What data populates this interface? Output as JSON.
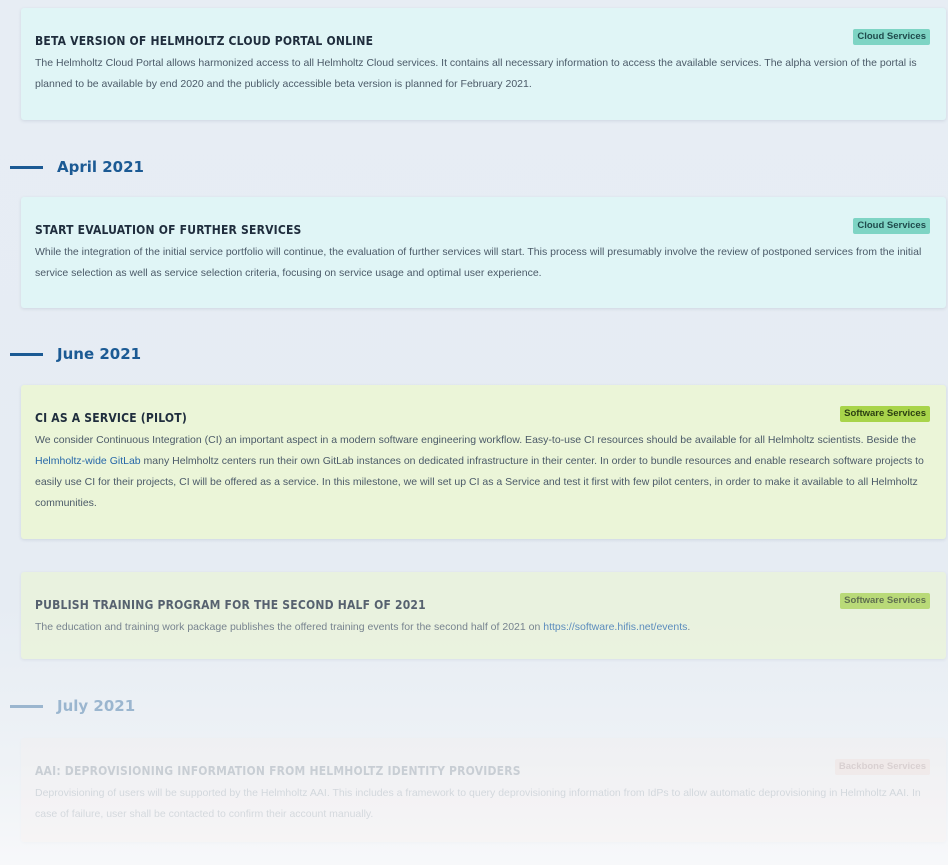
{
  "milestones": [
    {
      "title": "BETA VERSION OF HELMHOLTZ CLOUD PORTAL ONLINE",
      "badge": "Cloud Services",
      "text": "The Helmholtz Cloud Portal allows harmonized access to all Helmholtz Cloud services. It contains all necessary information to access the available services. The alpha version of the portal is planned to be available by end 2020 and the publicly accessible beta version is planned for February 2021."
    },
    {
      "title": "START EVALUATION OF FURTHER SERVICES",
      "badge": "Cloud Services",
      "text": "While the integration of the initial service portfolio will continue, the evaluation of further services will start. This process will presumably involve the review of postponed services from the initial service selection as well as service selection criteria, focusing on service usage and optimal user experience."
    },
    {
      "title": "CI AS A SERVICE (PILOT)",
      "badge": "Software Services",
      "text_before": "We consider Continuous Integration (CI) an important aspect in a modern software engineering workflow. Easy-to-use CI resources should be available for all Helmholtz scientists. Beside the ",
      "link": "Helmholtz-wide GitLab",
      "text_after": " many Helmholtz centers run their own GitLab instances on dedicated infrastructure in their center. In order to bundle resources and enable research software projects to easily use CI for their projects, CI will be offered as a service. In this milestone, we will set up CI as a Service and test it first with few pilot centers, in order to make it available to all Helmholtz communities."
    },
    {
      "title": "PUBLISH TRAINING PROGRAM FOR THE SECOND HALF OF 2021",
      "badge": "Software Services",
      "text_before": "The education and training work package publishes the offered training events for the second half of 2021 on ",
      "link": "https://software.hifis.net/events",
      "text_after": "."
    },
    {
      "title": "AAI: DEPROVISIONING INFORMATION FROM HELMHOLTZ IDENTITY PROVIDERS",
      "badge": "Backbone Services",
      "text": "Deprovisioning of users will be supported by the Helmholtz AAI. This includes a framework to query deprovisioning information from IdPs to allow automatic deprovisioning in Helmholtz AAI. In case of failure, user shall be contacted to confirm their account manually."
    }
  ],
  "months": {
    "april": "April 2021",
    "june": "June 2021",
    "july": "July 2021"
  },
  "colors": {
    "accent": "#1b5a94",
    "cloud_bg": "#e0f5f6",
    "software_bg": "#ebf5d8",
    "backbone_bg": "#fdeee8",
    "cloud_badge": "#7ed4c4",
    "software_badge": "#a8d44a",
    "backbone_badge": "#f6c2b3",
    "link": "#2667a8"
  }
}
